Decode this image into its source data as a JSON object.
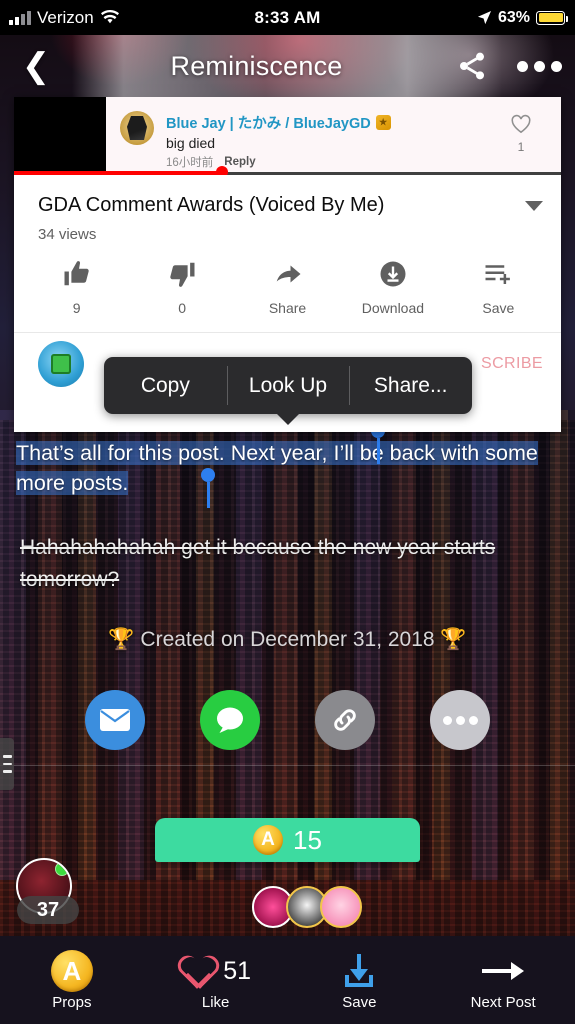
{
  "status_bar": {
    "carrier": "Verizon",
    "time": "8:33 AM",
    "battery_percent": "63%",
    "signal_icon": "signal-bars-icon",
    "wifi_icon": "wifi-icon",
    "location_icon": "location-arrow-icon",
    "battery_icon": "battery-low-power-icon",
    "battery_color": "#fdd835"
  },
  "nav": {
    "back_icon": "chevron-left-icon",
    "title": "Reminiscence",
    "share_icon": "share-icon",
    "more_icon": "more-horizontal-icon"
  },
  "youtube": {
    "comment": {
      "author": "Blue Jay | たかみ / BlueJayGD",
      "badge": "verified-creator-badge",
      "text": "big died",
      "time": "16小时前",
      "reply_label": "Reply",
      "like_icon": "heart-outline-icon",
      "like_count": "1"
    },
    "title": "GDA Comment Awards (Voiced By Me)",
    "caret_icon": "chevron-down-icon",
    "views": "34 views",
    "actions": [
      {
        "icon": "thumbs-up-icon",
        "label": "9"
      },
      {
        "icon": "thumbs-down-icon",
        "label": "0"
      },
      {
        "icon": "share-arrow-icon",
        "label": "Share"
      },
      {
        "icon": "download-circle-icon",
        "label": "Download"
      },
      {
        "icon": "save-playlist-icon",
        "label": "Save"
      }
    ],
    "channel_avatar_icon": "geometry-dash-avatar",
    "subscribe_label": "SCRIBE",
    "progress_color": "#ff0000"
  },
  "edit_menu": {
    "items": [
      {
        "label": "Copy"
      },
      {
        "label": "Look Up"
      },
      {
        "label": "Share..."
      }
    ]
  },
  "post": {
    "selected_text_part1": "That’s all for this post. Next year,",
    "selected_text_part2": " I’ll be back with some more posts.",
    "strikethrough_text": " Hahahahahahah get it because the new year starts tomorrow?",
    "created_line": "🏆 Created on December 31, 2018 🏆",
    "selection_color": "#2d7ff0"
  },
  "share_sheet": {
    "targets": [
      {
        "name": "mail-share-icon",
        "color": "#3b8ede"
      },
      {
        "name": "messages-share-icon",
        "color": "#28cd41"
      },
      {
        "name": "copy-link-icon",
        "color": "#8a8a8e"
      },
      {
        "name": "more-share-icon",
        "color": "#c7c7cc"
      }
    ]
  },
  "props_banner": {
    "coin_icon": "amino-coin-icon",
    "count": "15",
    "color": "#3ddba0"
  },
  "author": {
    "level_badge": "37",
    "online_status": "online"
  },
  "bottom_bar": {
    "items": [
      {
        "icon": "amino-coin-icon",
        "label": "Props",
        "count": ""
      },
      {
        "icon": "heart-outline-icon",
        "label": "Like",
        "count": "51"
      },
      {
        "icon": "download-icon",
        "label": "Save",
        "count": ""
      },
      {
        "icon": "arrow-right-icon",
        "label": "Next Post",
        "count": ""
      }
    ],
    "background": "#16121e"
  },
  "drawer_tab": {
    "icon": "hamburger-menu-icon"
  }
}
